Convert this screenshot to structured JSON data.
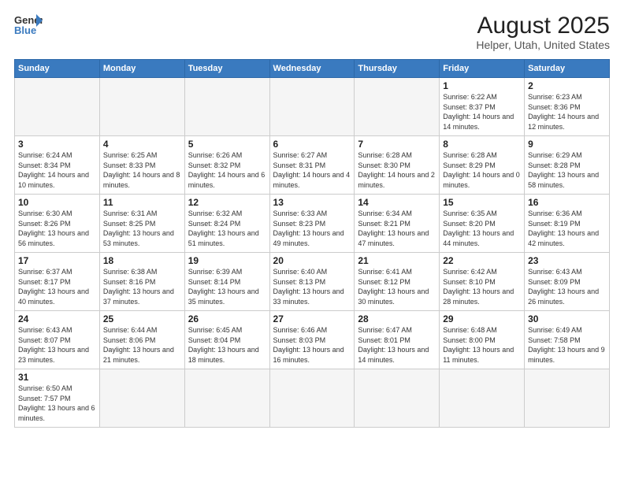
{
  "logo": {
    "text_general": "General",
    "text_blue": "Blue"
  },
  "title": "August 2025",
  "subtitle": "Helper, Utah, United States",
  "weekdays": [
    "Sunday",
    "Monday",
    "Tuesday",
    "Wednesday",
    "Thursday",
    "Friday",
    "Saturday"
  ],
  "weeks": [
    [
      {
        "day": "",
        "info": ""
      },
      {
        "day": "",
        "info": ""
      },
      {
        "day": "",
        "info": ""
      },
      {
        "day": "",
        "info": ""
      },
      {
        "day": "",
        "info": ""
      },
      {
        "day": "1",
        "info": "Sunrise: 6:22 AM\nSunset: 8:37 PM\nDaylight: 14 hours and 14 minutes."
      },
      {
        "day": "2",
        "info": "Sunrise: 6:23 AM\nSunset: 8:36 PM\nDaylight: 14 hours and 12 minutes."
      }
    ],
    [
      {
        "day": "3",
        "info": "Sunrise: 6:24 AM\nSunset: 8:34 PM\nDaylight: 14 hours and 10 minutes."
      },
      {
        "day": "4",
        "info": "Sunrise: 6:25 AM\nSunset: 8:33 PM\nDaylight: 14 hours and 8 minutes."
      },
      {
        "day": "5",
        "info": "Sunrise: 6:26 AM\nSunset: 8:32 PM\nDaylight: 14 hours and 6 minutes."
      },
      {
        "day": "6",
        "info": "Sunrise: 6:27 AM\nSunset: 8:31 PM\nDaylight: 14 hours and 4 minutes."
      },
      {
        "day": "7",
        "info": "Sunrise: 6:28 AM\nSunset: 8:30 PM\nDaylight: 14 hours and 2 minutes."
      },
      {
        "day": "8",
        "info": "Sunrise: 6:28 AM\nSunset: 8:29 PM\nDaylight: 14 hours and 0 minutes."
      },
      {
        "day": "9",
        "info": "Sunrise: 6:29 AM\nSunset: 8:28 PM\nDaylight: 13 hours and 58 minutes."
      }
    ],
    [
      {
        "day": "10",
        "info": "Sunrise: 6:30 AM\nSunset: 8:26 PM\nDaylight: 13 hours and 56 minutes."
      },
      {
        "day": "11",
        "info": "Sunrise: 6:31 AM\nSunset: 8:25 PM\nDaylight: 13 hours and 53 minutes."
      },
      {
        "day": "12",
        "info": "Sunrise: 6:32 AM\nSunset: 8:24 PM\nDaylight: 13 hours and 51 minutes."
      },
      {
        "day": "13",
        "info": "Sunrise: 6:33 AM\nSunset: 8:23 PM\nDaylight: 13 hours and 49 minutes."
      },
      {
        "day": "14",
        "info": "Sunrise: 6:34 AM\nSunset: 8:21 PM\nDaylight: 13 hours and 47 minutes."
      },
      {
        "day": "15",
        "info": "Sunrise: 6:35 AM\nSunset: 8:20 PM\nDaylight: 13 hours and 44 minutes."
      },
      {
        "day": "16",
        "info": "Sunrise: 6:36 AM\nSunset: 8:19 PM\nDaylight: 13 hours and 42 minutes."
      }
    ],
    [
      {
        "day": "17",
        "info": "Sunrise: 6:37 AM\nSunset: 8:17 PM\nDaylight: 13 hours and 40 minutes."
      },
      {
        "day": "18",
        "info": "Sunrise: 6:38 AM\nSunset: 8:16 PM\nDaylight: 13 hours and 37 minutes."
      },
      {
        "day": "19",
        "info": "Sunrise: 6:39 AM\nSunset: 8:14 PM\nDaylight: 13 hours and 35 minutes."
      },
      {
        "day": "20",
        "info": "Sunrise: 6:40 AM\nSunset: 8:13 PM\nDaylight: 13 hours and 33 minutes."
      },
      {
        "day": "21",
        "info": "Sunrise: 6:41 AM\nSunset: 8:12 PM\nDaylight: 13 hours and 30 minutes."
      },
      {
        "day": "22",
        "info": "Sunrise: 6:42 AM\nSunset: 8:10 PM\nDaylight: 13 hours and 28 minutes."
      },
      {
        "day": "23",
        "info": "Sunrise: 6:43 AM\nSunset: 8:09 PM\nDaylight: 13 hours and 26 minutes."
      }
    ],
    [
      {
        "day": "24",
        "info": "Sunrise: 6:43 AM\nSunset: 8:07 PM\nDaylight: 13 hours and 23 minutes."
      },
      {
        "day": "25",
        "info": "Sunrise: 6:44 AM\nSunset: 8:06 PM\nDaylight: 13 hours and 21 minutes."
      },
      {
        "day": "26",
        "info": "Sunrise: 6:45 AM\nSunset: 8:04 PM\nDaylight: 13 hours and 18 minutes."
      },
      {
        "day": "27",
        "info": "Sunrise: 6:46 AM\nSunset: 8:03 PM\nDaylight: 13 hours and 16 minutes."
      },
      {
        "day": "28",
        "info": "Sunrise: 6:47 AM\nSunset: 8:01 PM\nDaylight: 13 hours and 14 minutes."
      },
      {
        "day": "29",
        "info": "Sunrise: 6:48 AM\nSunset: 8:00 PM\nDaylight: 13 hours and 11 minutes."
      },
      {
        "day": "30",
        "info": "Sunrise: 6:49 AM\nSunset: 7:58 PM\nDaylight: 13 hours and 9 minutes."
      }
    ],
    [
      {
        "day": "31",
        "info": "Sunrise: 6:50 AM\nSunset: 7:57 PM\nDaylight: 13 hours and 6 minutes."
      },
      {
        "day": "",
        "info": ""
      },
      {
        "day": "",
        "info": ""
      },
      {
        "day": "",
        "info": ""
      },
      {
        "day": "",
        "info": ""
      },
      {
        "day": "",
        "info": ""
      },
      {
        "day": "",
        "info": ""
      }
    ]
  ]
}
